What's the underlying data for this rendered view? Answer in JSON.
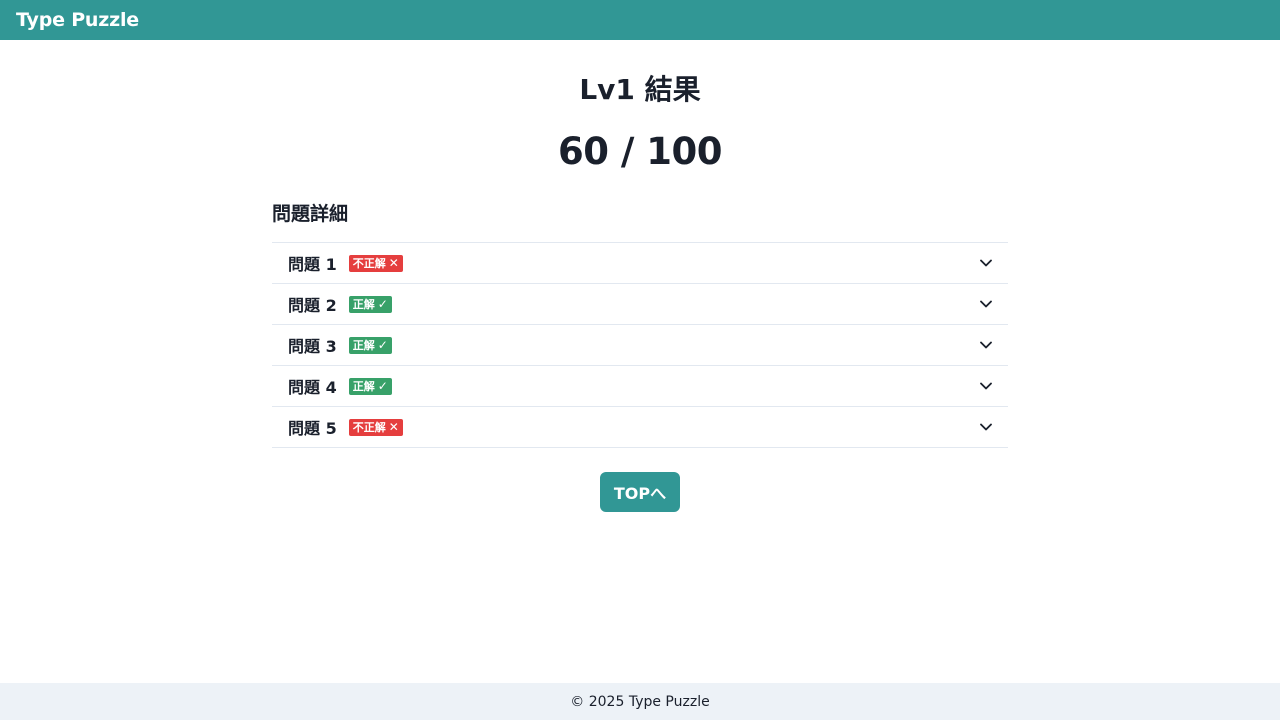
{
  "header": {
    "brand": "Type Puzzle",
    "color": "#319795"
  },
  "result": {
    "title": "Lv1 結果",
    "score": "60 / 100"
  },
  "details": {
    "section_title": "問題詳細",
    "questions": [
      {
        "label": "問題 1",
        "status": "wrong",
        "badge_text": "不正解",
        "mark": "✕"
      },
      {
        "label": "問題 2",
        "status": "correct",
        "badge_text": "正解",
        "mark": "✓"
      },
      {
        "label": "問題 3",
        "status": "correct",
        "badge_text": "正解",
        "mark": "✓"
      },
      {
        "label": "問題 4",
        "status": "correct",
        "badge_text": "正解",
        "mark": "✓"
      },
      {
        "label": "問題 5",
        "status": "wrong",
        "badge_text": "不正解",
        "mark": "✕"
      }
    ],
    "expand_icon": "chevron-down-icon",
    "colors": {
      "wrong": "#e53e3e",
      "correct": "#38a169"
    }
  },
  "actions": {
    "top_button": "TOPへ"
  },
  "footer": {
    "copyright": "© 2025 Type Puzzle"
  }
}
